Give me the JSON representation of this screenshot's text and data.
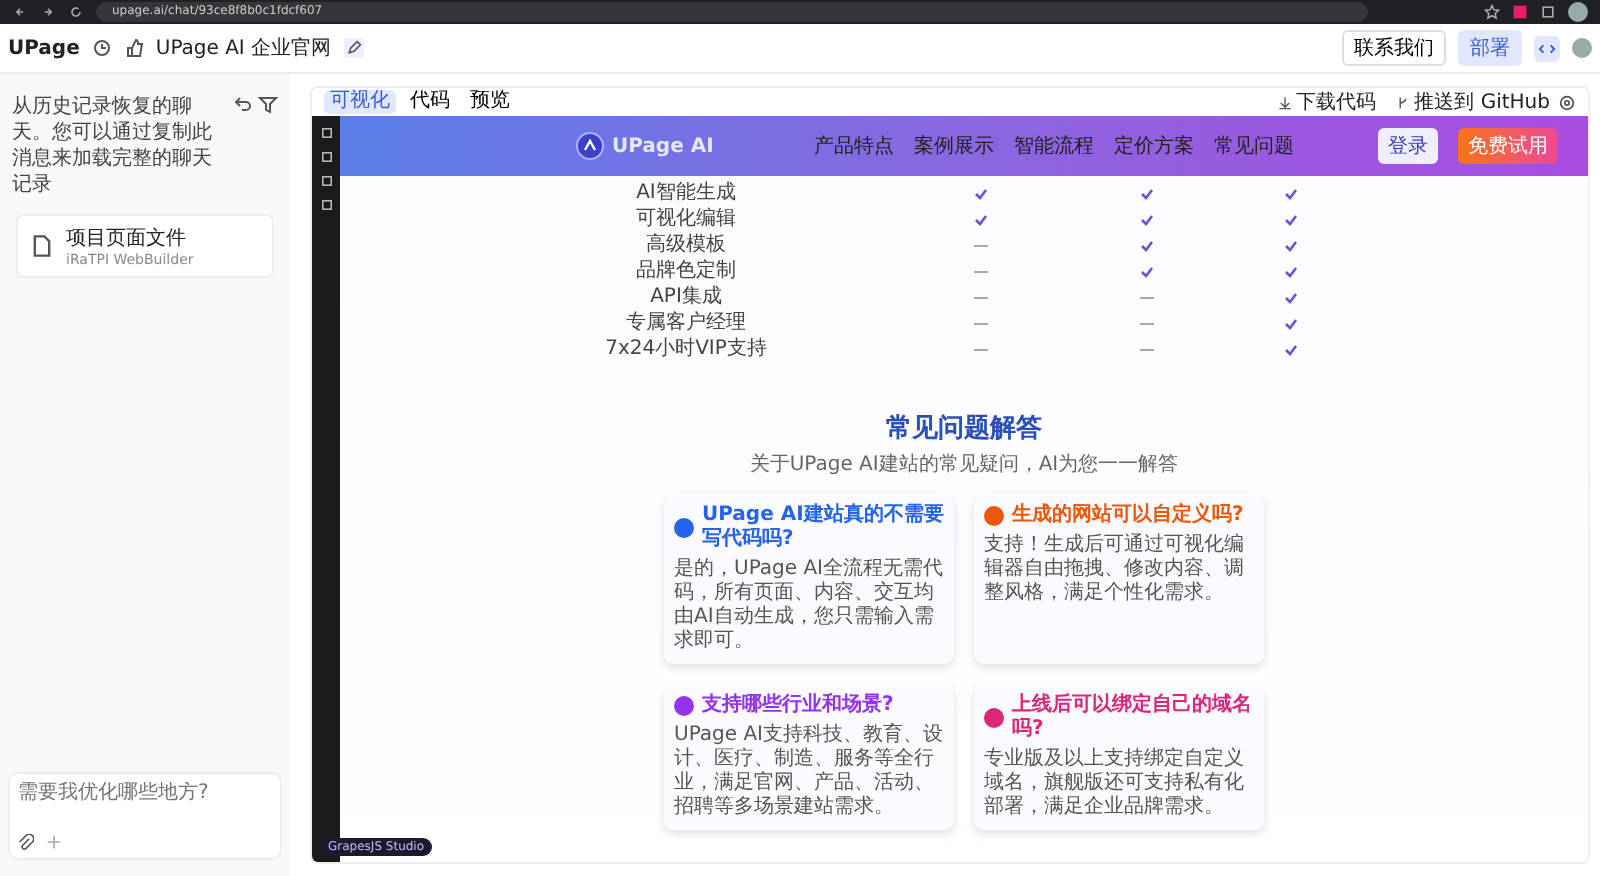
{
  "browser": {
    "url": "upage.ai/chat/93ce8f8b0c1fdcf607"
  },
  "header": {
    "logo": "UPage",
    "project_title": "UPage AI 企业官网",
    "contact_button": "联系我们",
    "deploy_button": "部署"
  },
  "chat": {
    "message": "从历史记录恢复的聊天。您可以通过复制此消息来加载完整的聊天记录",
    "artifact": {
      "title": "项目页面文件",
      "subtitle": "iRaTPI WebBuilder"
    },
    "input": {
      "placeholder": "需要我优化哪些地方?"
    }
  },
  "preview": {
    "tabs": [
      {
        "label": "可视化",
        "selected": true
      },
      {
        "label": "代码",
        "selected": false
      },
      {
        "label": "预览",
        "selected": false
      }
    ],
    "actions": [
      "下载代码",
      "推送到 GitHub"
    ],
    "site": {
      "logo": "UPage AI",
      "nav": [
        "产品特点",
        "案例展示",
        "智能流程",
        "定价方案",
        "常见问题"
      ],
      "login": "登录",
      "trial": "免费试用",
      "features": [
        {
          "name": "AI智能生成",
          "included": [
            true,
            true,
            true
          ]
        },
        {
          "name": "可视化编辑",
          "included": [
            true,
            true,
            true
          ]
        },
        {
          "name": "高级模板",
          "included": [
            false,
            true,
            true
          ]
        },
        {
          "name": "品牌色定制",
          "included": [
            false,
            true,
            true
          ]
        },
        {
          "name": "API集成",
          "included": [
            false,
            false,
            true
          ]
        },
        {
          "name": "专属客户经理",
          "included": [
            false,
            false,
            true
          ]
        },
        {
          "name": "7x24小时VIP支持",
          "included": [
            false,
            false,
            true
          ]
        }
      ],
      "faq_title": "常见问题解答",
      "faq_subtitle": "关于UPage AI建站的常见疑问，AI为您一一解答",
      "faq": [
        {
          "question": "UPage AI建站真的不需要写代码吗?",
          "answer": "是的，UPage AI全流程无需代码，所有页面、内容、交互均由AI自动生成，您只需输入需求即可。",
          "color": "#2563eb"
        },
        {
          "question": "生成的网站可以自定义吗?",
          "answer": "支持！生成后可通过可视化编辑器自由拖拽、修改内容、调整风格，满足个性化需求。",
          "color": "#ea580c"
        },
        {
          "question": "支持哪些行业和场景?",
          "answer": "UPage AI支持科技、教育、设计、医疗、制造、服务等全行业，满足官网、产品、活动、招聘等多场景建站需求。",
          "color": "#9333ea"
        },
        {
          "question": "上线后可以绑定自己的域名吗?",
          "answer": "专业版及以上支持绑定自定义域名，旗舰版还可支持私有化部署，满足企业品牌需求。",
          "color": "#db2777"
        }
      ]
    },
    "badge": "GrapesJS Studio"
  }
}
